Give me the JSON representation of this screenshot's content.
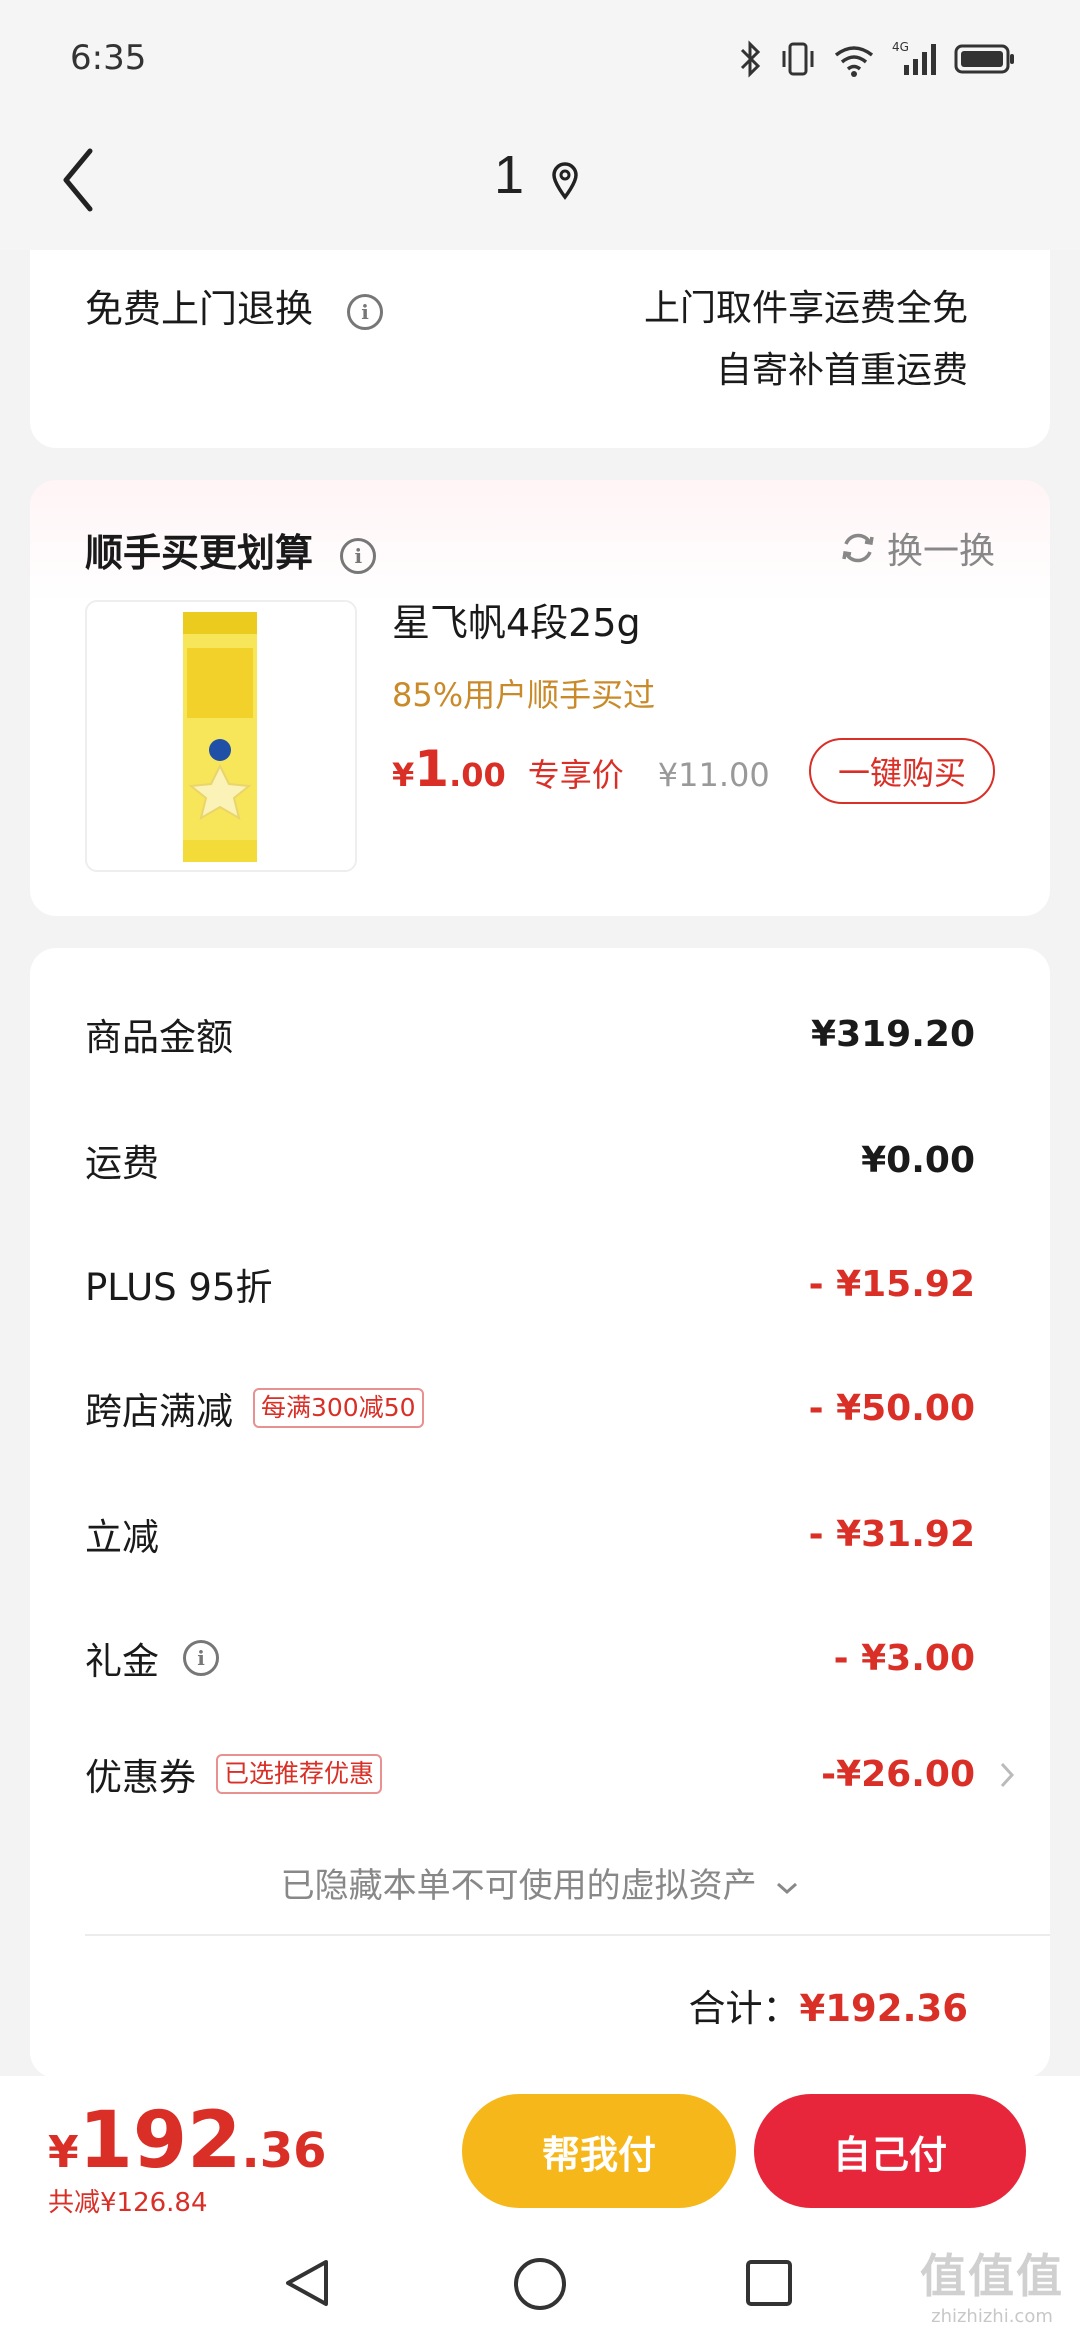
{
  "status": {
    "time": "6:35",
    "network": "4G"
  },
  "header": {
    "title": "1"
  },
  "service": {
    "label": "免费上门退换",
    "line1": "上门取件享运费全免",
    "line2": "自寄补首重运费"
  },
  "addon": {
    "title": "顺手买更划算",
    "refresh": "换一换",
    "product": {
      "name": "星飞帆4段25g",
      "subtitle": "85%用户顺手买过",
      "currency": "¥",
      "price_int": "1",
      "price_dec": ".00",
      "price_tag": "专享价",
      "original_price": "¥11.00",
      "buy_label": "一键购买"
    }
  },
  "summary": {
    "rows": [
      {
        "label": "商品金额",
        "value": "¥319.20"
      },
      {
        "label": "运费",
        "value": "¥0.00"
      },
      {
        "label": "PLUS 95折",
        "value": "- ¥15.92"
      },
      {
        "label": "跨店满减",
        "tag": "每满300减50",
        "value": "- ¥50.00"
      },
      {
        "label": "立减",
        "value": "- ¥31.92"
      },
      {
        "label": "礼金",
        "value": "- ¥3.00"
      },
      {
        "label": "优惠券",
        "tag": "已选推荐优惠",
        "value": "-¥26.00"
      }
    ],
    "hidden_note": "已隐藏本单不可使用的虚拟资产",
    "total_label": "合计：",
    "total_value": "¥192.36"
  },
  "footer": {
    "currency": "¥",
    "total_int": "192",
    "total_dec": ".36",
    "saved": "共减¥126.84",
    "help_pay": "帮我付",
    "self_pay": "自己付"
  },
  "watermark": {
    "text": "值值值",
    "url": "zhizhizhi.com"
  },
  "colors": {
    "accent_red": "#d92f26",
    "help_yellow": "#f6b71a",
    "self_red": "#e8263b",
    "subtitle_gold": "#c98a2a"
  }
}
